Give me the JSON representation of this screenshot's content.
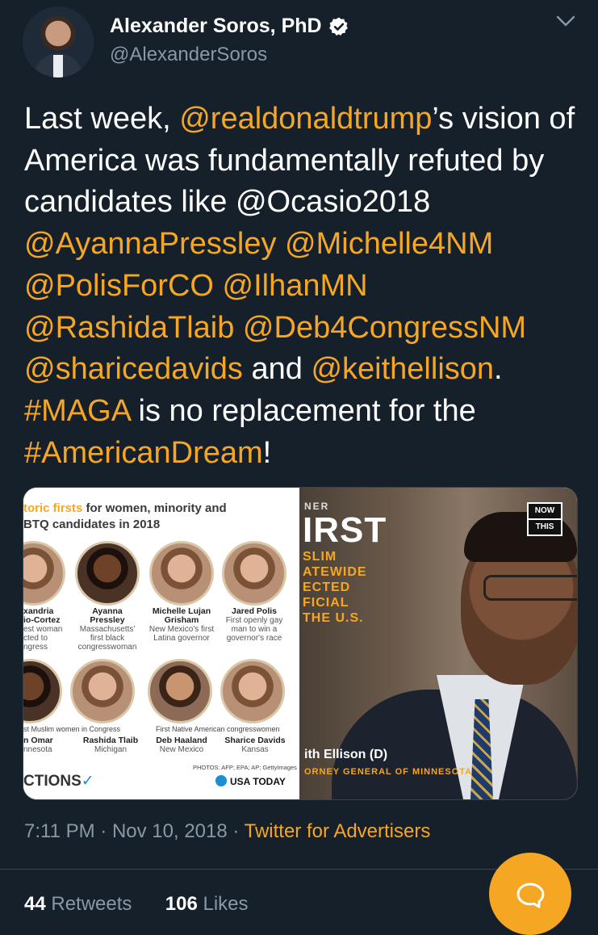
{
  "author": {
    "name": "Alexander Soros, PhD",
    "handle": "@AlexanderSoros",
    "verified": true
  },
  "tweet": {
    "segments": [
      {
        "t": "Last week, ",
        "mention": false
      },
      {
        "t": "@realdonaldtrump",
        "mention": true
      },
      {
        "t": "’s vision of America was fundamentally refuted by candidates like ",
        "mention": false
      },
      {
        "t": "@Ocasio2018",
        "mention": false
      },
      {
        "t": " ",
        "mention": false
      },
      {
        "t": "@AyannaPressley",
        "mention": true
      },
      {
        "t": " ",
        "mention": false
      },
      {
        "t": "@Michelle4NM",
        "mention": true
      },
      {
        "t": " ",
        "mention": false
      },
      {
        "t": "@PolisForCO",
        "mention": true
      },
      {
        "t": " ",
        "mention": false
      },
      {
        "t": "@IlhanMN",
        "mention": true
      },
      {
        "t": " ",
        "mention": false
      },
      {
        "t": "@RashidaTlaib",
        "mention": true
      },
      {
        "t": " ",
        "mention": false
      },
      {
        "t": "@Deb4CongressNM",
        "mention": true
      },
      {
        "t": " ",
        "mention": false
      },
      {
        "t": "@sharicedavids",
        "mention": true
      },
      {
        "t": " and ",
        "mention": false
      },
      {
        "t": "@keithellison",
        "mention": true
      },
      {
        "t": ". ",
        "mention": false
      },
      {
        "t": "#MAGA",
        "mention": true
      },
      {
        "t": " is no replacement for the ",
        "mention": false
      },
      {
        "t": "#AmericanDream",
        "mention": true
      },
      {
        "t": "!",
        "mention": false
      }
    ]
  },
  "media_left": {
    "heading_accent": "toric firsts",
    "heading_rest": " for women, minority and",
    "heading_line2": "BTQ candidates in 2018",
    "people": [
      {
        "name": "xandria\nio-Cortez",
        "desc": "est woman\ncted to\nngress"
      },
      {
        "name": "Ayanna\nPressley",
        "desc": "Massachusetts'\nfirst black\ncongresswoman"
      },
      {
        "name": "Michelle Lujan\nGrisham",
        "desc": "New Mexico's first\nLatina governor"
      },
      {
        "name": "Jared Polis",
        "desc": "First openly gay\nman to win a\ngovernor's race"
      }
    ],
    "row2_label_a": "st Muslim women in Congress",
    "row2_label_b": "First Native American congresswomen",
    "people2": [
      {
        "name": "n Omar",
        "desc": "nnesota"
      },
      {
        "name": "Rashida Tlaib",
        "desc": "Michigan"
      },
      {
        "name": "Deb Haaland",
        "desc": "New Mexico"
      },
      {
        "name": "Sharice Davids",
        "desc": "Kansas"
      }
    ],
    "photos_credit": "PHOTOS: AFP; EPA; AP; GettyImages",
    "footer_left": "CTIONS",
    "footer_right": "USA TODAY"
  },
  "media_right": {
    "kicker": "NER",
    "big": "IRST",
    "lines": [
      "SLIM",
      "ATEWIDE",
      "ECTED",
      "FICIAL",
      "THE U.S."
    ],
    "logo_top": "NOW",
    "logo_bottom": "THIS",
    "name": "ith Ellison (D)",
    "title": "ORNEY GENERAL OF MINNESOTA"
  },
  "meta": {
    "time": "7:11 PM",
    "sep": " · ",
    "date": "Nov 10, 2018",
    "source": "Twitter for Advertisers"
  },
  "counts": {
    "retweets_num": "44",
    "retweets_label": "Retweets",
    "likes_num": "106",
    "likes_label": "Likes"
  },
  "colors": {
    "background": "#15202b",
    "accent": "#f5a623",
    "secondary_text": "#8899a6"
  },
  "icons": {
    "verified": "verified-badge-icon",
    "menu": "chevron-down-icon",
    "compose": "reply-bubble-icon"
  }
}
